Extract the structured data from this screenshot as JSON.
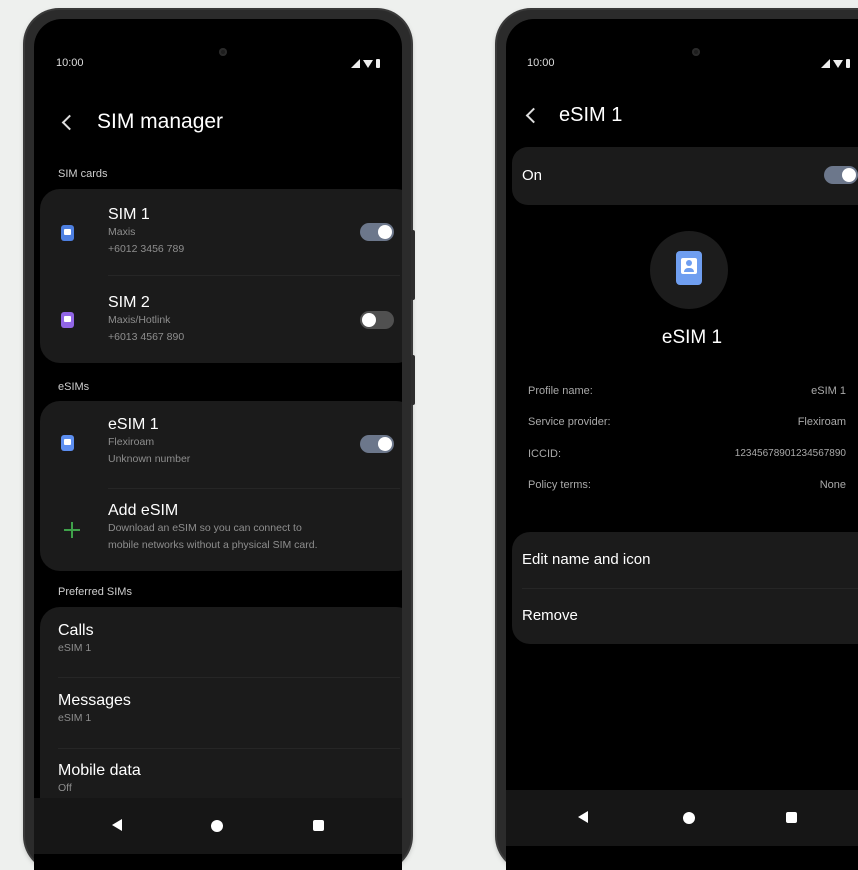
{
  "left_screen": {
    "status_time": "10:00",
    "title": "SIM manager",
    "sections": {
      "sim_cards": "SIM cards",
      "esims": "eSIMs",
      "preferred": "Preferred SIMs"
    },
    "sim1": {
      "name": "SIM 1",
      "carrier": "Maxis",
      "number": "+6012 3456 789",
      "enabled": true
    },
    "sim2": {
      "name": "SIM 2",
      "carrier": "Maxis/Hotlink",
      "number": "+6013 4567 890",
      "enabled": false
    },
    "esim1": {
      "name": "eSIM 1",
      "carrier": "Flexiroam",
      "number": "Unknown number",
      "enabled": true
    },
    "add_esim": {
      "title": "Add eSIM",
      "line1": "Download an eSIM so you can connect to",
      "line2": "mobile networks without a physical SIM card."
    },
    "preferred": [
      {
        "title": "Calls",
        "value": "eSIM 1"
      },
      {
        "title": "Messages",
        "value": "eSIM 1"
      },
      {
        "title": "Mobile data",
        "value": "Off"
      }
    ]
  },
  "right_screen": {
    "status_time": "10:00",
    "title": "eSIM 1",
    "on_label": "On",
    "on_enabled": true,
    "profile_title": "eSIM 1",
    "info": [
      {
        "label": "Profile name:",
        "value": "eSIM 1"
      },
      {
        "label": "Service provider:",
        "value": "Flexiroam"
      },
      {
        "label": "ICCID:",
        "value": "12345678901234567890"
      },
      {
        "label": "Policy terms:",
        "value": "None"
      }
    ],
    "actions": [
      "Edit name and icon",
      "Remove"
    ]
  },
  "colors": {
    "sim1_icon": "#4d7fe0",
    "sim2_icon": "#9166e6",
    "esim_icon": "#5c8ef0",
    "plus": "#3fa14a",
    "toggle_on": "#6c778b",
    "toggle_off": "#505050",
    "card_bg": "#1b1b1b"
  },
  "icons": [
    "back-chevron",
    "signal",
    "wifi",
    "battery",
    "sim-card",
    "esim-card",
    "plus",
    "nav-back",
    "nav-home",
    "nav-recents"
  ]
}
